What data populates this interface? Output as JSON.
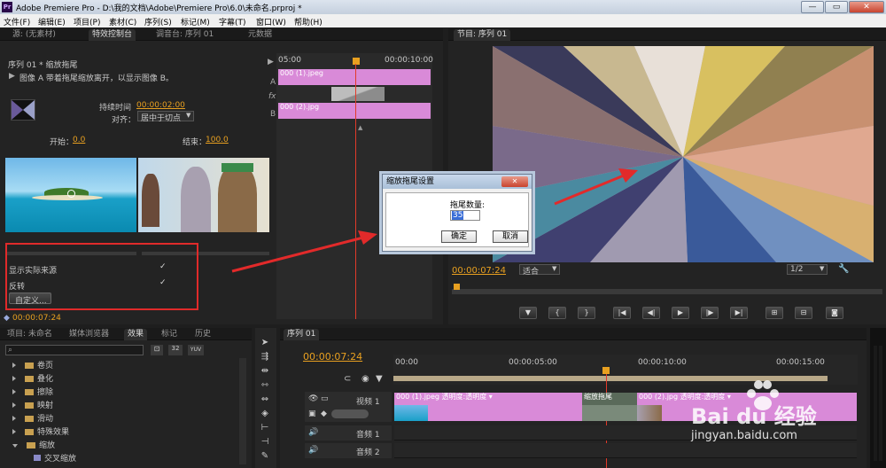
{
  "window": {
    "title": "Adobe Premiere Pro - D:\\我的文档\\Adobe\\Premiere Pro\\6.0\\未命名.prproj *",
    "app_icon": "Pr",
    "minimize": "—",
    "maximize": "▭",
    "close": "✕"
  },
  "menu": [
    "文件(F)",
    "编辑(E)",
    "项目(P)",
    "素材(C)",
    "序列(S)",
    "标记(M)",
    "字幕(T)",
    "窗口(W)",
    "帮助(H)"
  ],
  "effect_controls": {
    "tabs": [
      "源: (无素材)",
      "特效控制台",
      "调音台: 序列 01",
      "元数据"
    ],
    "sequence_label": "序列 01 * 缩放拖尾",
    "description": "图像 A 带着拖尾缩放离开，以显示图像 B。",
    "duration_label": "持续时间",
    "duration_value": "00:00:02:00",
    "align_label": "对齐：",
    "align_value": "居中于切点",
    "start_label": "开始：",
    "start_value": "0.0",
    "end_label": "结束：",
    "end_value": "100.0",
    "show_actual_sources": "显示实际来源",
    "reverse": "反转",
    "custom_button": "自定义...",
    "timecode": "00:00:07:24",
    "mini_timeline_start": "05:00",
    "mini_timeline_end": "00:00:10:00",
    "clip_a": "000 (1).jpeg",
    "clip_b": "000 (2).jpg",
    "track_a_letter": "A",
    "track_b_letter": "B",
    "fx_letter": "fx"
  },
  "dialog": {
    "title": "缩放拖尾设置",
    "field_label": "拖尾数量:",
    "field_value": "35",
    "ok": "确定",
    "cancel": "取消"
  },
  "program_monitor": {
    "tab": "节目: 序列 01",
    "timecode": "00:00:07:24",
    "fit": "适合",
    "resolution": "1/2",
    "transport": [
      "▼",
      "{",
      "}",
      "|◀",
      "◀|",
      "▶",
      "|▶",
      "▶|",
      "⊞",
      "⊟",
      "◙"
    ]
  },
  "project_panel": {
    "tabs": [
      "项目: 未命名",
      "媒体浏览器",
      "效果",
      "标记",
      "历史"
    ],
    "effects_tree": [
      "卷页",
      "叠化",
      "擦除",
      "映射",
      "滑动",
      "特殊效果",
      "缩放"
    ],
    "sub_item": "交叉缩放",
    "preset_badges": [
      "32",
      "YUV"
    ]
  },
  "timeline": {
    "tab": "序列 01",
    "timecode": "00:00:07:24",
    "ruler": [
      "00:00",
      "00:00:05:00",
      "00:00:10:00",
      "00:00:15:00"
    ],
    "video_track": "视频 1",
    "audio_tracks": [
      "音频 1",
      "音频 2"
    ],
    "clip1_label": "000 (1).jpeg  透明度:透明度 ▾",
    "transition_label": "缩放拖尾",
    "clip2_label": "000 (2).jpg  透明度:透明度 ▾"
  },
  "watermark": {
    "brand": "Bai du 经验",
    "url": "jingyan.baidu.com"
  }
}
